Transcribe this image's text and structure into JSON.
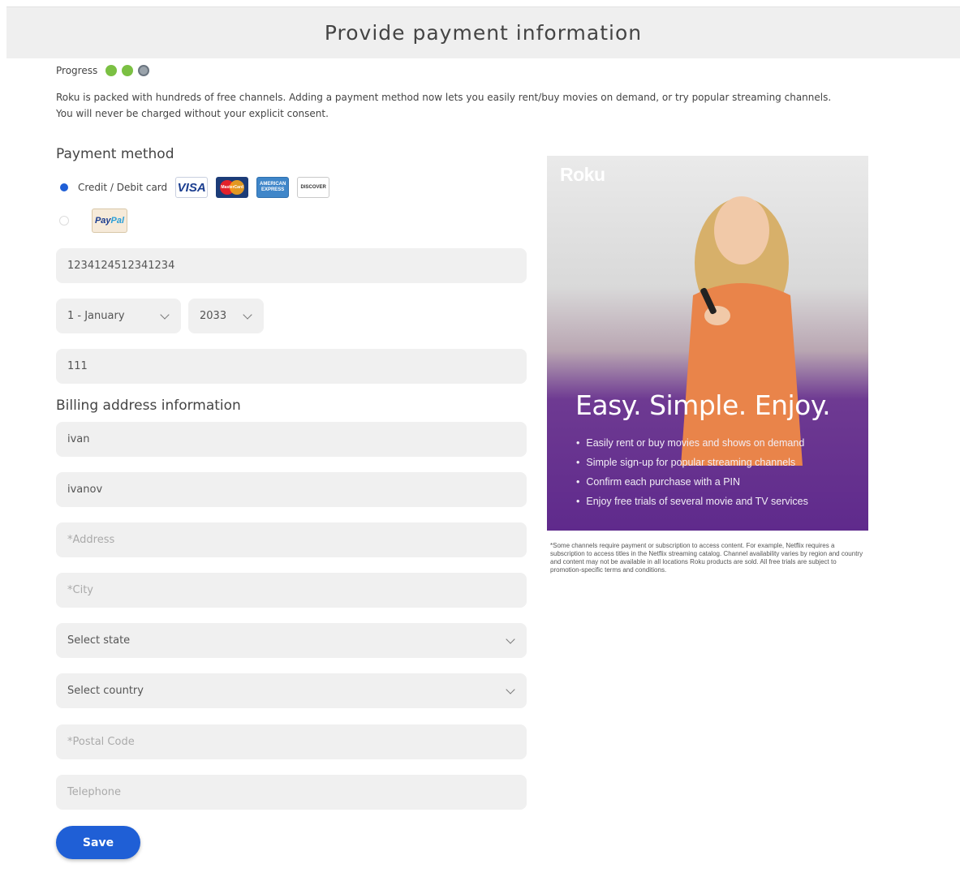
{
  "header": {
    "title": "Provide payment information"
  },
  "progress": {
    "label": "Progress",
    "steps": [
      "done",
      "done",
      "current"
    ]
  },
  "intro": "Roku is packed with hundreds of free channels. Adding a payment method now lets you easily rent/buy movies on demand, or try popular streaming channels. You will never be charged without your explicit consent.",
  "payment": {
    "section_title": "Payment method",
    "credit_label": "Credit / Debit card",
    "cards": {
      "visa": "VISA",
      "mastercard": "MasterCard",
      "amex_line1": "AMERICAN",
      "amex_line2": "EXPRESS",
      "discover": "DISCOVER"
    },
    "paypal": {
      "p1": "Pay",
      "p2": "Pal"
    },
    "selected": "credit",
    "card_number": "1234124512341234",
    "exp_month": "1 - January",
    "exp_year": "2033",
    "cvv": "111"
  },
  "billing": {
    "section_title": "Billing address information",
    "first_name": "ivan",
    "last_name": "ivanov",
    "address_placeholder": "*Address",
    "city_placeholder": "*City",
    "state": "Select state",
    "country": "Select country",
    "postal_placeholder": "*Postal Code",
    "telephone_placeholder": "Telephone"
  },
  "save_label": "Save",
  "promo": {
    "logo": "Roku",
    "tagline": "Easy. Simple. Enjoy.",
    "bullets": [
      "Easily rent or buy movies and shows on demand",
      "Simple sign-up for popular streaming channels",
      "Confirm each purchase with a PIN",
      "Enjoy free trials of several movie and TV services"
    ],
    "disclaimer": "*Some channels require payment or subscription to access content. For example, Netflix requires a subscription to access titles in the Netflix streaming catalog. Channel availability varies by region and country and content may not be available in all locations Roku products are sold. All free trials are subject to promotion-specific terms and conditions."
  },
  "colors": {
    "accent": "#1f5fd6",
    "progress_done": "#7bc043",
    "field_bg": "#f0f0f0",
    "promo_purple": "#5f2a8c"
  }
}
